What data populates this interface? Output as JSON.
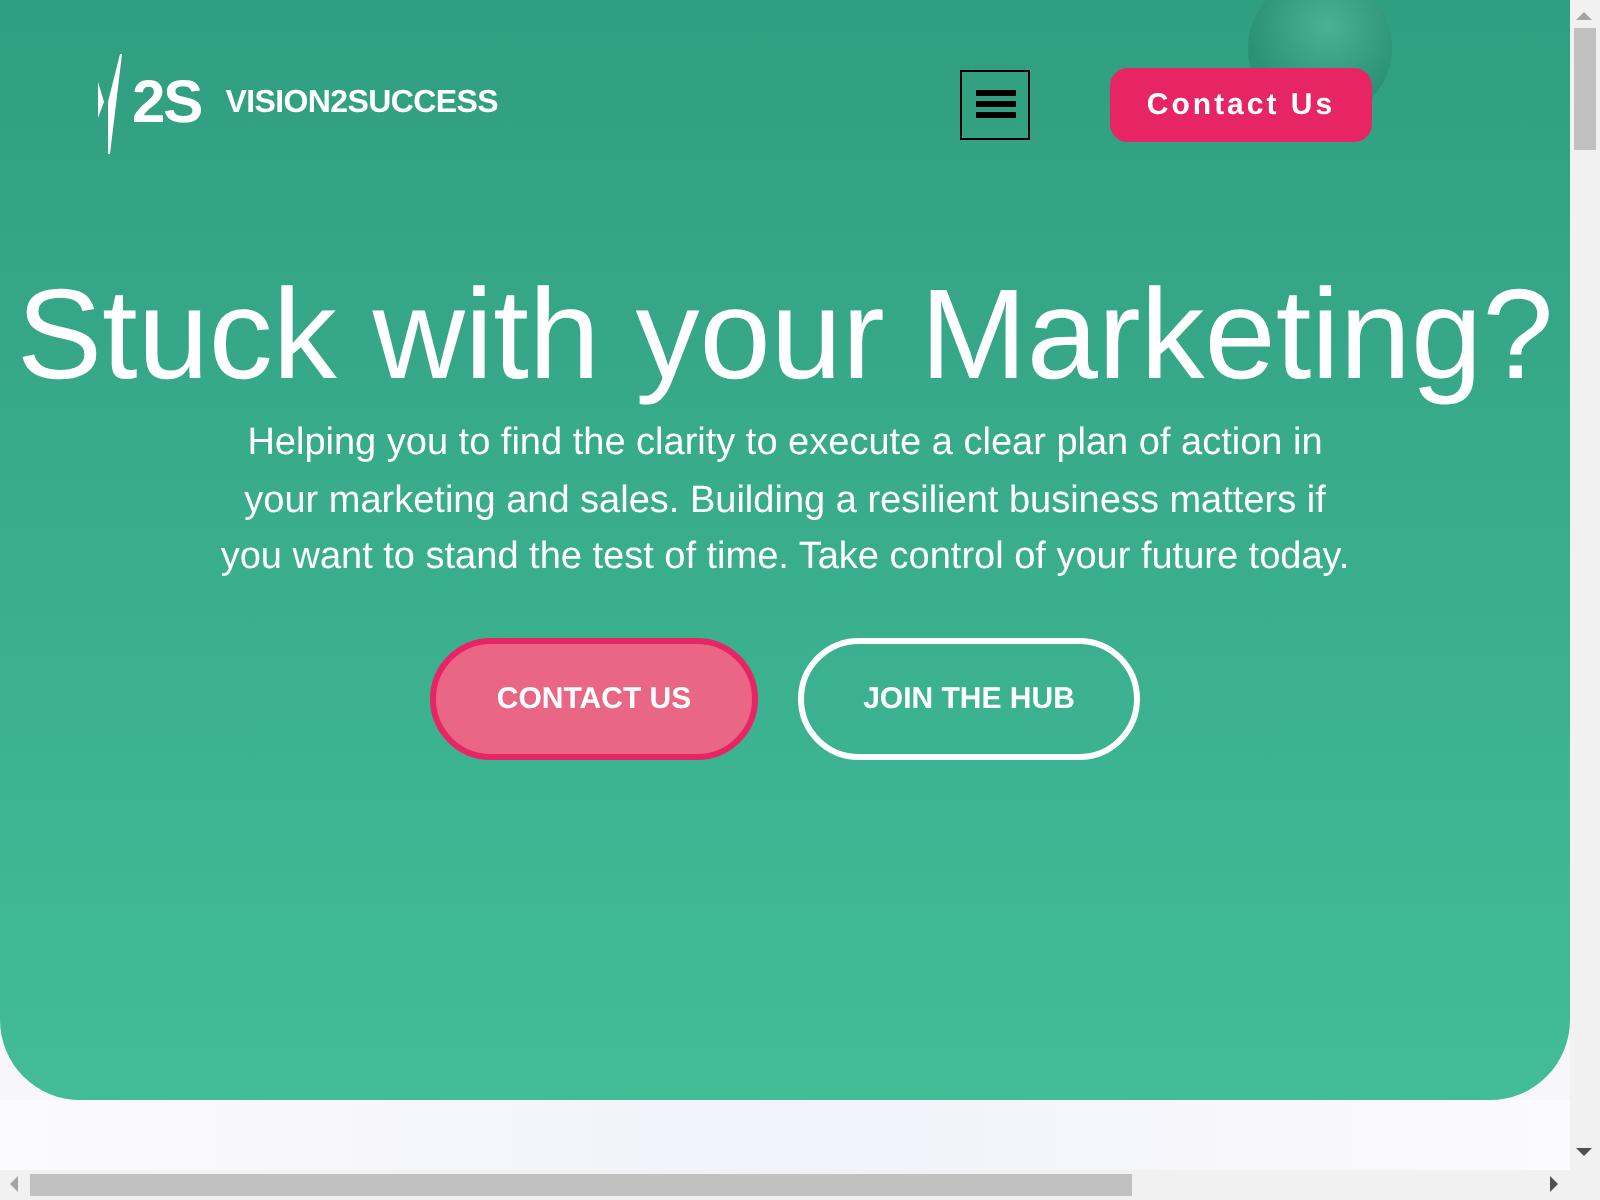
{
  "header": {
    "logo": {
      "mark": "2S",
      "name": "VISION2SUCCESS"
    },
    "contact_button": "Contact Us"
  },
  "hero": {
    "title": "Stuck with your Marketing?",
    "text": "Helping you to find the clarity to execute a clear plan of action in your marketing and sales. Building a resilient business matters if you want to stand the test of time. Take control of your future today.",
    "buttons": [
      {
        "label": "CONTACT US",
        "kind": "filled"
      },
      {
        "label": "JOIN THE HUB",
        "kind": "outline"
      }
    ]
  }
}
